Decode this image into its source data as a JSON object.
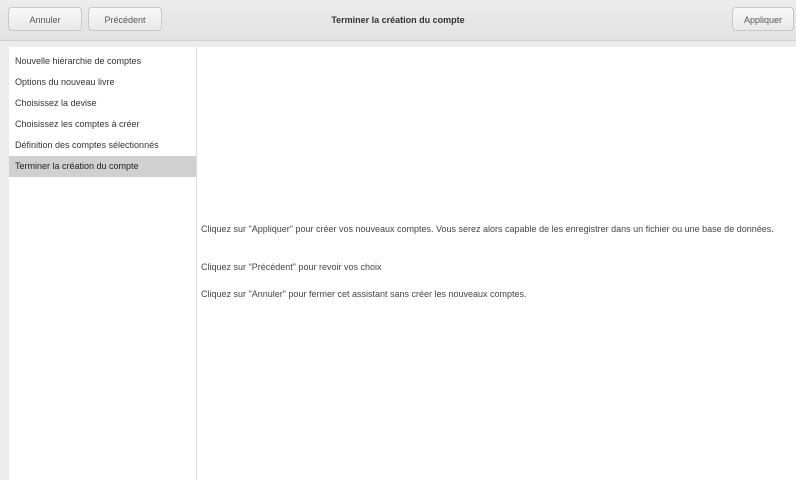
{
  "header": {
    "cancel_label": "Annuler",
    "previous_label": "Précédent",
    "title": "Terminer la création du compte",
    "apply_label": "Appliquer"
  },
  "sidebar": {
    "items": [
      {
        "label": "Nouvelle hiérarchie de comptes"
      },
      {
        "label": "Options du nouveau livre"
      },
      {
        "label": "Choisissez la devise"
      },
      {
        "label": "Choisissez les comptes à créer"
      },
      {
        "label": "Définition des comptes sélectionnés"
      },
      {
        "label": "Terminer la création du compte"
      }
    ],
    "selected_index": 5
  },
  "content": {
    "apply_message": "Cliquez sur \"Appliquer\" pour créer vos nouveaux comptes. Vous serez alors capable de les enregistrer dans un fichier ou une base de données.",
    "previous_message": "Cliquez sur \"Précédent\" pour revoir vos choix",
    "cancel_message": "Cliquez sur \"Annuler\" pour fermer cet assistant sans créer les nouveaux comptes."
  }
}
